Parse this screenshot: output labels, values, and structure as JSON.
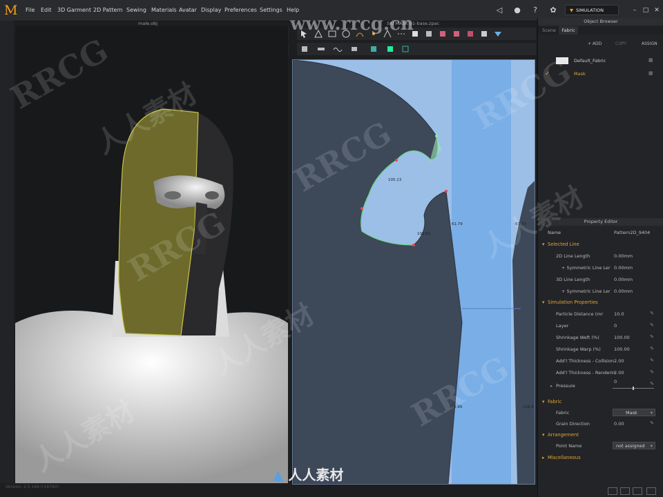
{
  "app": {
    "logo": "M",
    "sim_label": "SIMULATION"
  },
  "menu": [
    "File",
    "Edit",
    "3D Garment",
    "2D Pattern",
    "Sewing",
    "Materials",
    "Avatar",
    "Display",
    "Preferences",
    "Settings",
    "Help"
  ],
  "viewport3d": {
    "file_name": "male.obj",
    "version_text": "Version: 2.5.166     (r16760)"
  },
  "viewport2d": {
    "file_name": "SKI MASK 01-base.zpac",
    "measurements": [
      "105.13",
      "61.79",
      "100.61",
      "61.79",
      "216.99",
      "216.9"
    ]
  },
  "object_browser": {
    "title": "Object Browser",
    "tabs": [
      "Scene",
      "Fabric"
    ],
    "active_tab": "Fabric",
    "buttons": {
      "add": "+ ADD",
      "copy": "COPY",
      "assign": "ASSIGN"
    },
    "fabrics": [
      {
        "name": "Default_Fabric",
        "checked": false
      },
      {
        "name": "Mask",
        "checked": true
      }
    ]
  },
  "property_editor": {
    "title": "Property Editor",
    "name_label": "Name",
    "name_value": "Pattern2D_9404",
    "sections": {
      "selected_line": {
        "title": "Selected Line",
        "rows": [
          {
            "label": "2D Line Length",
            "value": "0.00mm"
          },
          {
            "label": "+ Symmetric Line Ler",
            "value": "0.00mm"
          },
          {
            "label": "3D Line Length",
            "value": "0.00mm"
          },
          {
            "label": "+ Symmetric Line Ler",
            "value": "0.00mm"
          }
        ]
      },
      "simulation": {
        "title": "Simulation Properties",
        "rows": [
          {
            "label": "Particle Distance (mr",
            "value": "10.0"
          },
          {
            "label": "Layer",
            "value": "0"
          },
          {
            "label": "Shrinkage Weft (%)",
            "value": "100.00"
          },
          {
            "label": "Shrinkage Warp (%)",
            "value": "100.00"
          },
          {
            "label": "Add'l Thickness - Collision",
            "value": "2.00"
          },
          {
            "label": "Add'l Thickness - Renderin",
            "value": "2.00"
          }
        ],
        "pressure_label": "Pressure",
        "pressure_value": "0",
        "pressure_slider": 0.5
      },
      "fabric": {
        "title": "Fabric",
        "fabric_label": "Fabric",
        "fabric_value": "Mask",
        "grain_label": "Grain Direction",
        "grain_value": "0.00"
      },
      "arrangement": {
        "title": "Arrangement",
        "point_label": "Point Name",
        "point_value": "not assigned"
      },
      "misc": {
        "title": "Miscellaneous"
      }
    }
  },
  "watermarks": [
    "RRCG",
    "人人素材",
    "www.rrcg.cn"
  ],
  "bottom_logo": "人人素材",
  "colors": {
    "accent": "#f0a020",
    "mask_yellow": "#6d6a2c",
    "pattern_bg": "#9cbfe8",
    "pattern_dark": "#3d4858"
  }
}
